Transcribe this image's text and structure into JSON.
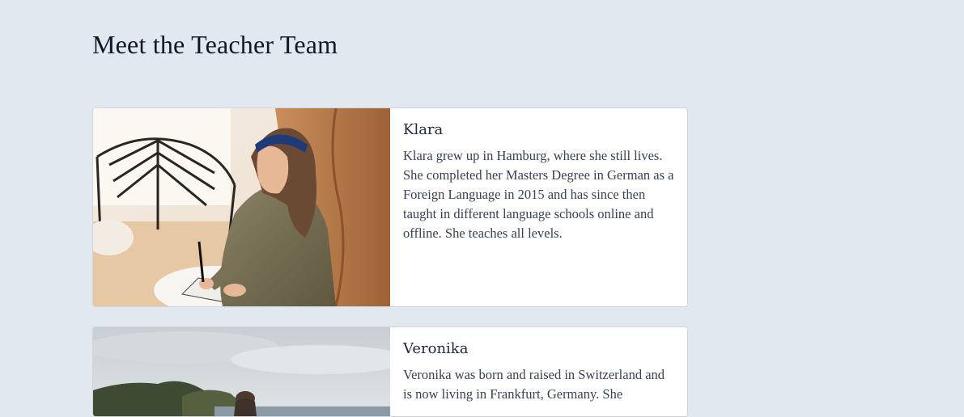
{
  "page": {
    "title": "Meet the Teacher Team"
  },
  "teachers": [
    {
      "name": "Klara",
      "bio": "Klara grew up in Hamburg, where she still lives. She completed her Masters Degree in German as a Foreign Language in 2015 and has since then taught in different language schools online and offline. She teaches all levels.",
      "photo_icon": "teacher-photo"
    },
    {
      "name": "Veronika",
      "bio": "Veronika was born and raised in Switzerland and is now living in Frankfurt, Germany. She",
      "photo_icon": "teacher-photo"
    }
  ],
  "colors": {
    "background": "#e2e8f0",
    "card": "#ffffff",
    "border": "#d1d5db",
    "text": "#1f2937"
  }
}
